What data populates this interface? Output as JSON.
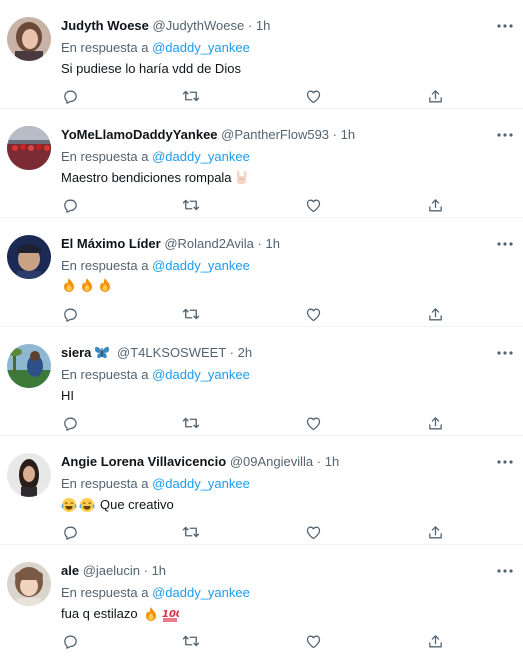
{
  "reply_prefix": "En respuesta a",
  "reply_target": "@daddy_yankee",
  "separator": "·",
  "colors": {
    "link": "#1d9bf0",
    "secondary_text": "#536471",
    "primary_text": "#0f1419",
    "divider": "#eff3f4"
  },
  "icons": [
    "reply-icon",
    "retweet-icon",
    "like-icon",
    "share-icon",
    "more-options-icon"
  ],
  "tweets": [
    {
      "name": "Judyth Woese",
      "handle": "@JudythWoese",
      "time": "1h",
      "text": "Si pudiese lo haría vdd de Dios",
      "emojis": []
    },
    {
      "name": "YoMeLlamoDaddyYankee",
      "handle": "@PantherFlow593",
      "time": "1h",
      "text": "Maestro bendiciones rompala",
      "emojis": [
        "rock-hand"
      ]
    },
    {
      "name": "El Máximo Líder",
      "handle": "@Roland2Avila",
      "time": "1h",
      "text": "",
      "emojis": [
        "fire",
        "fire",
        "fire"
      ]
    },
    {
      "name": "siera",
      "name_emoji": "butterfly",
      "handle": "@T4LKSOSWEET",
      "time": "2h",
      "text": "HI",
      "emojis": []
    },
    {
      "name": "Angie Lorena Villavicencio",
      "handle": "@09Angievilla",
      "time": "1h",
      "text": "Que creativo",
      "emojis_before": [
        "joy",
        "joy"
      ]
    },
    {
      "name": "ale",
      "handle": "@jaelucin",
      "time": "1h",
      "text": "fua q estilazo",
      "emojis": [
        "fire",
        "hundred"
      ]
    }
  ]
}
